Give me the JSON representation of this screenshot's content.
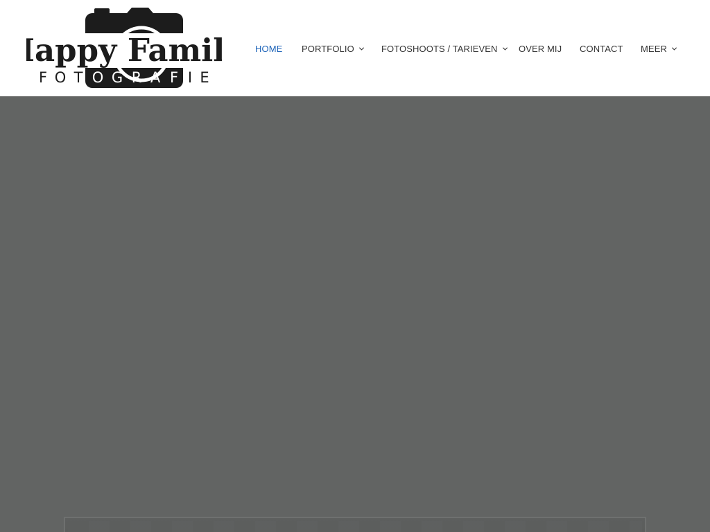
{
  "logo": {
    "title": "Happy Family",
    "subtitle_letters": [
      "F",
      "O",
      "T",
      "O",
      "G",
      "R",
      "A",
      "F",
      "I",
      "E"
    ],
    "color": "#1c1c1c"
  },
  "nav": {
    "items": [
      {
        "label": "HOME",
        "active": true,
        "has_dropdown": false
      },
      {
        "label": "PORTFOLIO",
        "active": false,
        "has_dropdown": true
      },
      {
        "label": "FOTOSHOOTS / TARIEVEN",
        "active": false,
        "has_dropdown": true
      },
      {
        "label": "OVER MIJ",
        "active": false,
        "has_dropdown": false
      },
      {
        "label": "CONTACT",
        "active": false,
        "has_dropdown": false
      },
      {
        "label": "MEER",
        "active": false,
        "has_dropdown": true
      }
    ],
    "active_color": "#1b62b8",
    "text_color": "#333333",
    "dropdown_icon": "chevron-down-icon"
  },
  "hero": {
    "background_color": "#626463"
  }
}
